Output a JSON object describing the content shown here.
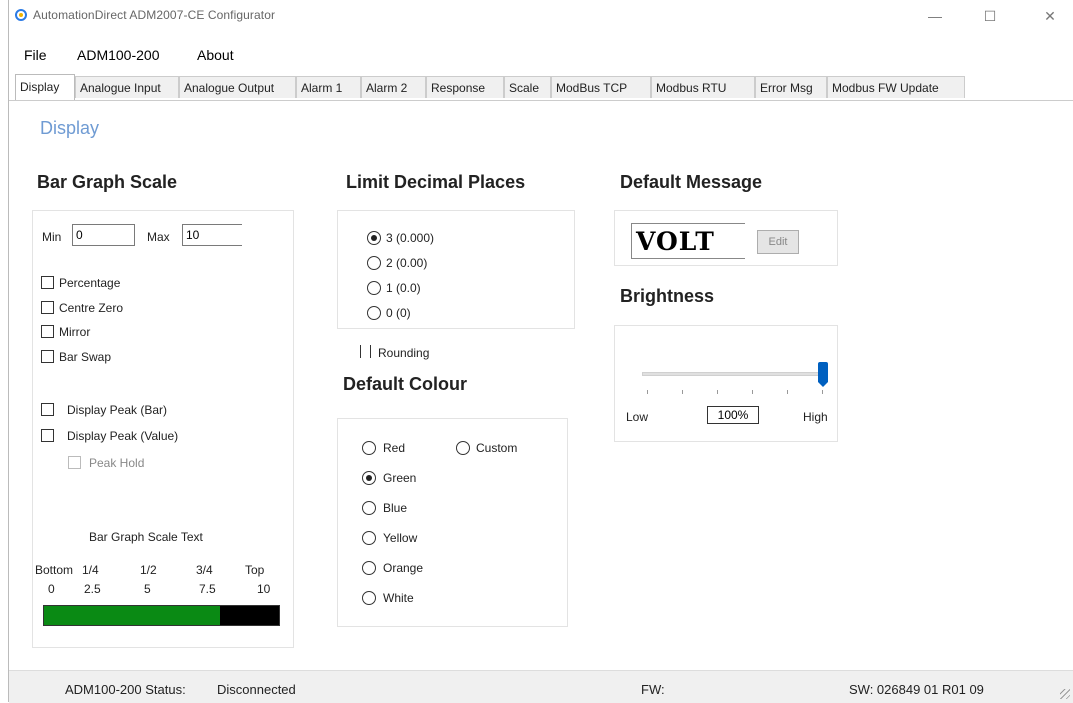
{
  "window": {
    "title": "AutomationDirect ADM2007-CE Configurator",
    "controls": {
      "minimize": "—",
      "maximize": "☐",
      "close": "✕"
    }
  },
  "menu": [
    "File",
    "ADM100-200",
    "About"
  ],
  "tabs": [
    {
      "label": "Display",
      "active": true
    },
    {
      "label": "Analogue Input"
    },
    {
      "label": "Analogue Output"
    },
    {
      "label": "Alarm 1"
    },
    {
      "label": "Alarm 2"
    },
    {
      "label": "Response"
    },
    {
      "label": "Scale"
    },
    {
      "label": "ModBus TCP"
    },
    {
      "label": "Modbus RTU"
    },
    {
      "label": "Error Msg"
    },
    {
      "label": "Modbus FW Update"
    }
  ],
  "page": {
    "heading": "Display"
  },
  "bar_graph": {
    "title": "Bar Graph Scale",
    "min_label": "Min",
    "min_value": "0",
    "max_label": "Max",
    "max_value": "10",
    "options": [
      "Percentage",
      "Centre Zero",
      "Mirror",
      "Bar Swap"
    ],
    "peak_options": [
      "Display Peak (Bar)",
      "Display Peak (Value)"
    ],
    "peak_hold": "Peak Hold",
    "scale_text_title": "Bar Graph Scale Text",
    "scale_positions": [
      "Bottom",
      "1/4",
      "1/2",
      "3/4",
      "Top"
    ],
    "scale_values": [
      "0",
      "2.5",
      "5",
      "7.5",
      "10"
    ],
    "fill_fraction": 0.75,
    "fill_color": "#0a8a14",
    "empty_color": "#000000"
  },
  "decimal": {
    "title": "Limit Decimal Places",
    "options": [
      "3 (0.000)",
      "2 (0.00)",
      "1 (0.0)",
      "0 (0)"
    ],
    "selected_index": 0,
    "rounding_label": "Rounding"
  },
  "colour": {
    "title": "Default Colour",
    "options": [
      "Red",
      "Green",
      "Blue",
      "Yellow",
      "Orange",
      "White"
    ],
    "custom_label": "Custom",
    "selected": "Green"
  },
  "message": {
    "title": "Default Message",
    "text": "VOLT",
    "edit_label": "Edit"
  },
  "brightness": {
    "title": "Brightness",
    "low_label": "Low",
    "high_label": "High",
    "value": "100%",
    "level": 1.0,
    "thumb_color": "#0060c0"
  },
  "status": {
    "device_label": "ADM100-200 Status:",
    "device_status": "Disconnected",
    "fw_label": "FW:",
    "sw_label": "SW: 026849 01 R01 09"
  }
}
